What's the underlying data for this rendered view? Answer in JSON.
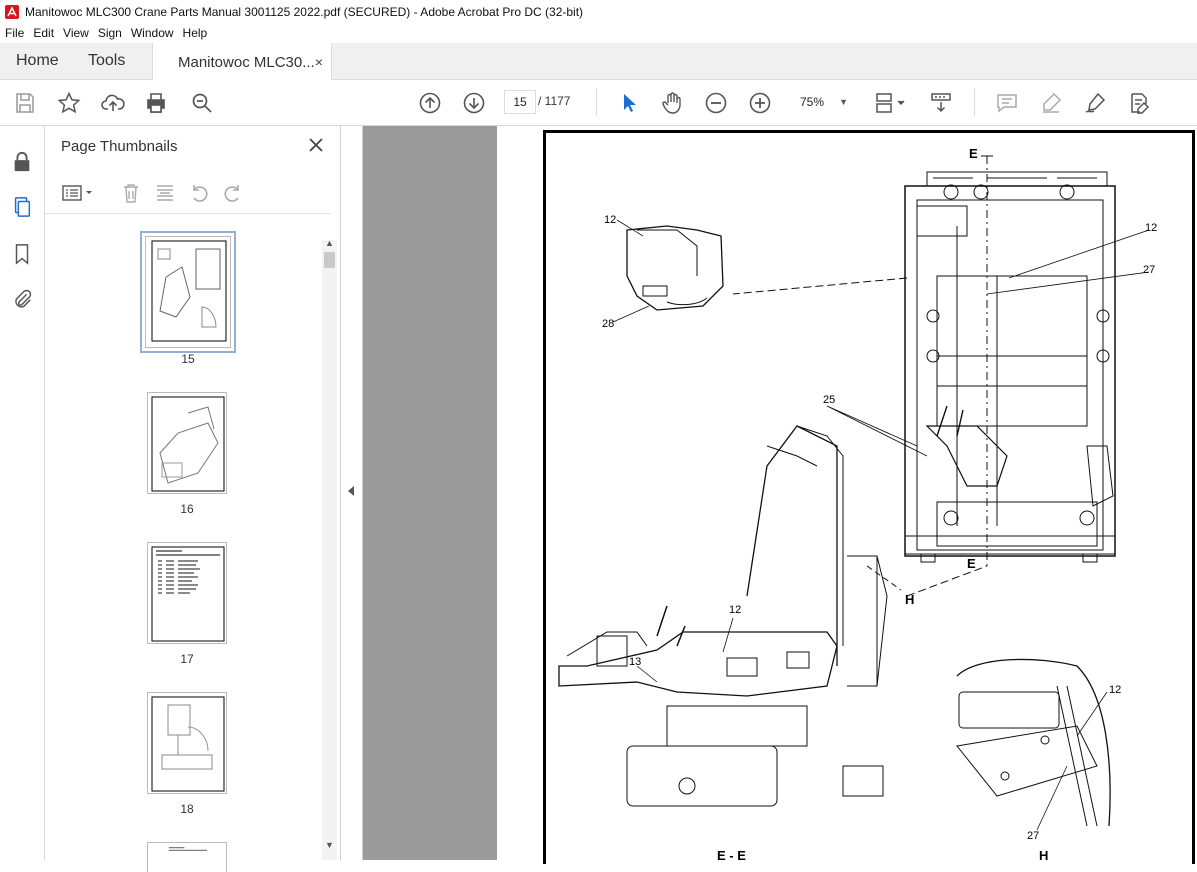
{
  "window": {
    "title": "Manitowoc MLC300 Crane Parts Manual 3001125 2022.pdf (SECURED) - Adobe Acrobat Pro DC (32-bit)"
  },
  "menu": [
    "File",
    "Edit",
    "View",
    "Sign",
    "Window",
    "Help"
  ],
  "tabs": {
    "home": "Home",
    "tools": "Tools",
    "document": "Manitowoc MLC30...",
    "close": "×"
  },
  "toolbar": {
    "current_page": "15",
    "page_total": "/ 1177",
    "zoom": "75%",
    "icons": [
      "save-icon",
      "star-icon",
      "upload-icon",
      "print-icon",
      "find-icon",
      "prev-page-icon",
      "next-page-icon",
      "select-cursor-icon",
      "hand-icon",
      "zoom-out-icon",
      "zoom-in-icon",
      "page-display-icon",
      "scroll-mode-icon",
      "comment-icon",
      "highlight-icon",
      "sign-icon",
      "fill-sign-icon"
    ]
  },
  "panel": {
    "title": "Page Thumbnails",
    "close": "×",
    "thumbnails": [
      {
        "label": "15",
        "selected": true
      },
      {
        "label": "16",
        "selected": false
      },
      {
        "label": "17",
        "selected": false
      },
      {
        "label": "18",
        "selected": false
      }
    ]
  },
  "drawing": {
    "callouts": [
      "12",
      "28",
      "12",
      "27",
      "25",
      "12",
      "13",
      "12",
      "27"
    ],
    "section_labels": [
      "E",
      "E",
      "H",
      "E - E",
      "H"
    ]
  }
}
